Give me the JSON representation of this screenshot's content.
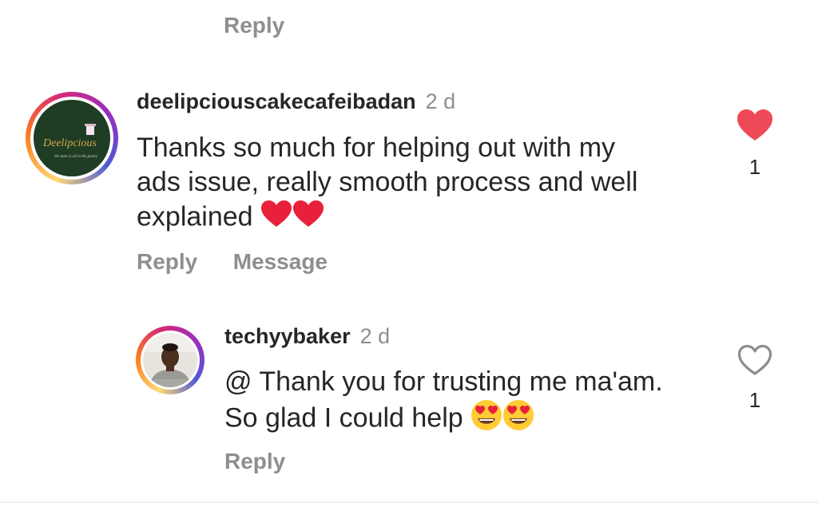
{
  "top_reply": {
    "reply_label": "Reply"
  },
  "comment": {
    "username": "deelipciouscakecafeibadan",
    "time": "2 d",
    "line1": "Thanks so much for helping out with my",
    "line2": "ads issue, really smooth process and well",
    "line3": "explained",
    "emojis": [
      "red-heart",
      "red-heart"
    ],
    "like_count": "1",
    "liked": true,
    "reply_label": "Reply",
    "message_label": "Message",
    "avatar_logo_text": "Deelipcious",
    "avatar_tagline": "the taste is all in the pastry"
  },
  "reply": {
    "username": "techyybaker",
    "time": "2 d",
    "line1": "@ Thank you for trusting me ma'am.",
    "line2": "So glad I could help",
    "emojis": [
      "heart-eyes",
      "heart-eyes"
    ],
    "like_count": "1",
    "liked": false,
    "reply_label": "Reply"
  },
  "colors": {
    "text": "#262626",
    "secondary": "#8e8e8e",
    "like_red": "#ed4956",
    "avatar_green": "#1e3d24"
  }
}
